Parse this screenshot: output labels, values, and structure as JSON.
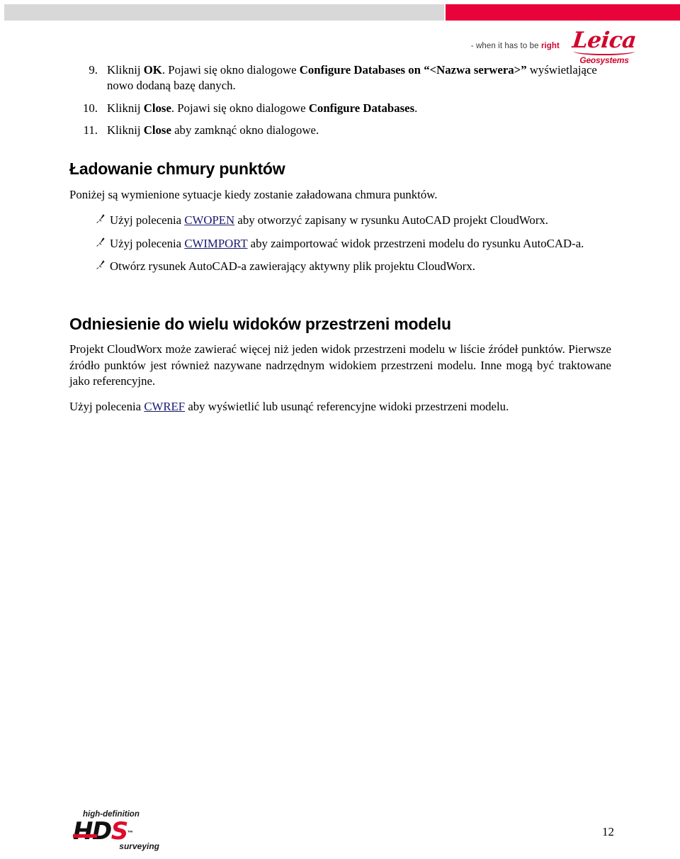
{
  "header": {
    "gray_bar": "",
    "red_bar": "",
    "colors": {
      "gray": "#d8d8d8",
      "red": "#e8033a",
      "brand_red": "#d2052e",
      "link_navy": "#191970"
    }
  },
  "brand": {
    "tagline_prefix": "- when it has to be ",
    "tagline_accent": "right",
    "logo_wordmark": "Leica",
    "logo_subword": "Geosystems"
  },
  "numbered_list": [
    {
      "number": "9.",
      "segments": [
        {
          "text": "Kliknij ",
          "style": "normal"
        },
        {
          "text": "OK",
          "style": "bold"
        },
        {
          "text": ". Pojawi się okno dialogowe ",
          "style": "normal"
        },
        {
          "text": "Configure Databases on “<Nazwa serwera>”",
          "style": "bold"
        },
        {
          "text": " wyświetlające nowo dodaną bazę danych.",
          "style": "normal"
        }
      ]
    },
    {
      "number": "10.",
      "segments": [
        {
          "text": "Kliknij ",
          "style": "normal"
        },
        {
          "text": "Close",
          "style": "bold"
        },
        {
          "text": ". Pojawi się okno dialogowe ",
          "style": "normal"
        },
        {
          "text": "Configure Databases",
          "style": "bold"
        },
        {
          "text": ".",
          "style": "normal"
        }
      ]
    },
    {
      "number": "11.",
      "segments": [
        {
          "text": "Kliknij ",
          "style": "normal"
        },
        {
          "text": "Close",
          "style": "bold"
        },
        {
          "text": " aby zamknąć okno dialogowe.",
          "style": "normal"
        }
      ]
    }
  ],
  "section1": {
    "heading": "Ładowanie chmury punktów",
    "lead": "Poniżej są wymienione sytuacje kiedy zostanie załadowana chmura punktów.",
    "bullets": [
      {
        "marker": "pen-bullet-icon",
        "segments": [
          {
            "text": "Użyj polecenia ",
            "style": "normal"
          },
          {
            "text": "CWOPEN",
            "style": "link"
          },
          {
            "text": " aby otworzyć zapisany w rysunku AutoCAD projekt CloudWorx.",
            "style": "normal"
          }
        ]
      },
      {
        "marker": "pen-bullet-icon",
        "segments": [
          {
            "text": "Użyj polecenia ",
            "style": "normal"
          },
          {
            "text": "CWIMPORT",
            "style": "link"
          },
          {
            "text": " aby zaimportować widok przestrzeni modelu do rysunku AutoCAD-a.",
            "style": "normal"
          }
        ]
      },
      {
        "marker": "pen-bullet-icon",
        "segments": [
          {
            "text": "Otwórz rysunek AutoCAD-a zawierający aktywny plik projektu CloudWorx.",
            "style": "normal"
          }
        ]
      }
    ]
  },
  "section2": {
    "heading": "Odniesienie do wielu widoków przestrzeni modelu",
    "paragraph": "Projekt CloudWorx może zawierać więcej niż jeden widok przestrzeni modelu w liście źródeł punktów. Pierwsze źródło punktów jest również nazywane nadrzędnym widokiem przestrzeni modelu. Inne mogą być traktowane jako referencyjne.",
    "closing": [
      {
        "text": "Użyj polecenia ",
        "style": "normal"
      },
      {
        "text": "CWREF",
        "style": "link"
      },
      {
        "text": " aby wyświetlić lub usunąć referencyjne widoki przestrzeni modelu.",
        "style": "normal"
      }
    ]
  },
  "footer": {
    "hds_top": "high-definition",
    "hds_letters": [
      {
        "text": "H",
        "color": "black"
      },
      {
        "text": "D",
        "color": "black"
      },
      {
        "text": "S",
        "color": "red"
      }
    ],
    "hds_tm": "™",
    "hds_bottom": "surveying",
    "page_number": "12"
  }
}
